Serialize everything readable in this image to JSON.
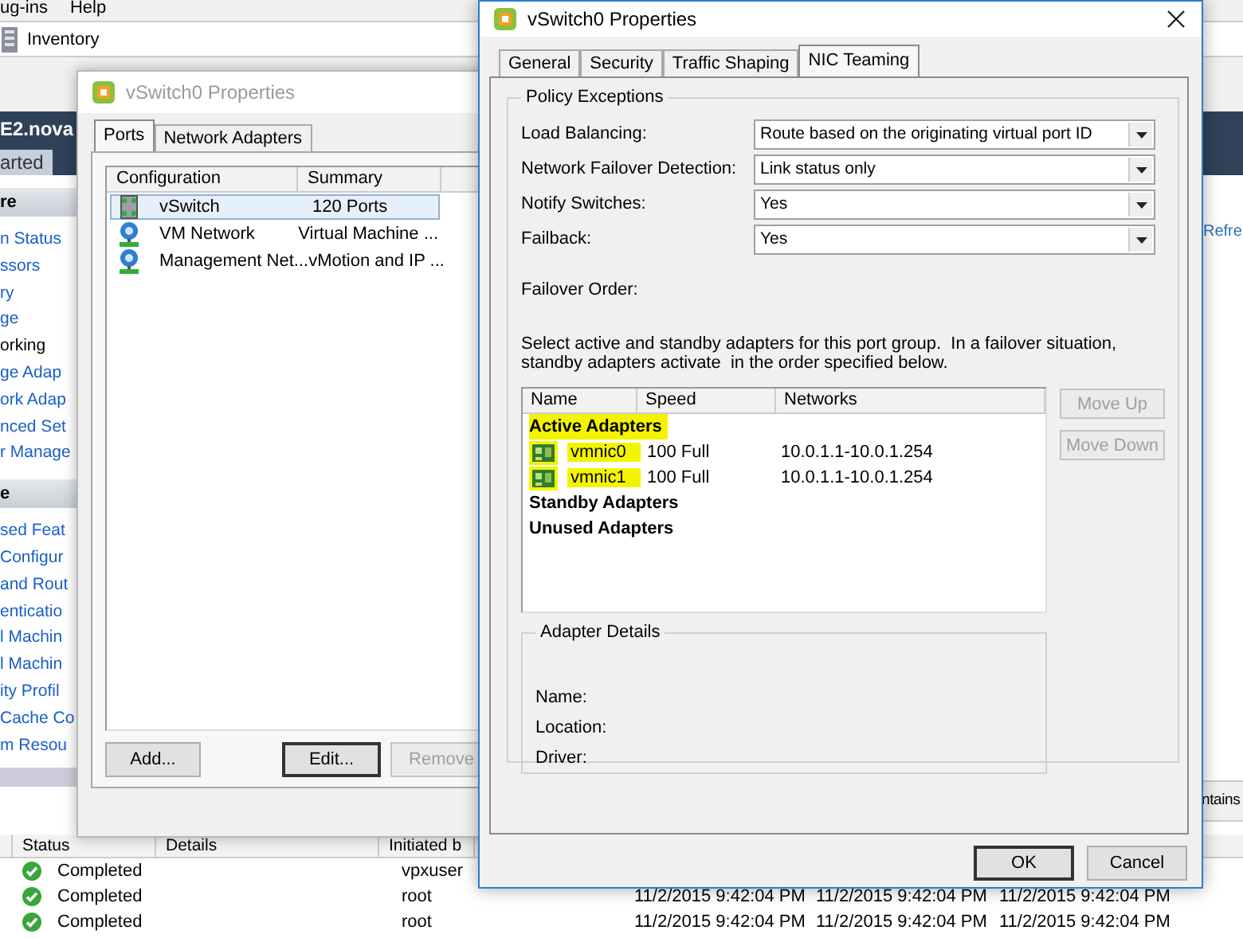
{
  "background_app": {
    "menu": [
      "ug-ins",
      "Help"
    ],
    "location": "Inventory",
    "host_title": "E2.nova",
    "tab": "arted",
    "sidebar_sections": [
      {
        "title": "re",
        "items": [
          {
            "label": "n Status",
            "selected": false
          },
          {
            "label": "ssors",
            "selected": false
          },
          {
            "label": "ry",
            "selected": false
          },
          {
            "label": "ge",
            "selected": false
          },
          {
            "label": "orking",
            "selected": true
          },
          {
            "label": "ge Adap",
            "selected": false
          },
          {
            "label": "ork Adap",
            "selected": false
          },
          {
            "label": "nced Set",
            "selected": false
          },
          {
            "label": "r Manage",
            "selected": false
          }
        ]
      },
      {
        "title": "e",
        "items": [
          {
            "label": "sed Feat",
            "selected": false
          },
          {
            "label": "Configur",
            "selected": false
          },
          {
            "label": "and Rout",
            "selected": false
          },
          {
            "label": "enticatio",
            "selected": false
          },
          {
            "label": "l Machin",
            "selected": false
          },
          {
            "label": "l Machin",
            "selected": false
          },
          {
            "label": "ity Profil",
            "selected": false
          },
          {
            "label": "Cache Co",
            "selected": false
          },
          {
            "label": "m Resou",
            "selected": false
          }
        ]
      }
    ],
    "refresh_link": "Refre",
    "filter_label": "ntains",
    "tasks": {
      "columns": [
        "Status",
        "Details",
        "Initiated b"
      ],
      "rows": [
        {
          "status": "Completed",
          "initiated_by": "vpxuser"
        },
        {
          "status": "Completed",
          "initiated_by": "root",
          "times": [
            "11/2/2015 9:42:04 PM",
            "11/2/2015 9:42:04 PM",
            "11/2/2015 9:42:04 PM"
          ]
        },
        {
          "status": "Completed",
          "initiated_by": "root",
          "times": [
            "11/2/2015 9:42:04 PM",
            "11/2/2015 9:42:04 PM",
            "11/2/2015 9:42:04 PM"
          ]
        }
      ]
    }
  },
  "ports_window": {
    "title": "vSwitch0 Properties",
    "tabs": [
      {
        "label": "Ports",
        "selected": true
      },
      {
        "label": "Network Adapters",
        "selected": false
      }
    ],
    "columns": [
      "Configuration",
      "Summary"
    ],
    "rows": [
      {
        "kind": "switch",
        "configuration": "vSwitch",
        "summary": "120 Ports",
        "selected": true
      },
      {
        "kind": "network",
        "configuration": "VM Network",
        "summary": "Virtual Machine ...",
        "selected": false
      },
      {
        "kind": "network",
        "configuration": "Management Net...",
        "summary": "vMotion and IP ...",
        "selected": false
      }
    ],
    "buttons": [
      {
        "label": "Add...",
        "default": false,
        "disabled": false
      },
      {
        "label": "Edit...",
        "default": true,
        "disabled": false
      },
      {
        "label": "Remove",
        "default": false,
        "disabled": true
      }
    ]
  },
  "teaming_window": {
    "title": "vSwitch0 Properties",
    "tabs": [
      {
        "label": "General",
        "selected": false
      },
      {
        "label": "Security",
        "selected": false
      },
      {
        "label": "Traffic Shaping",
        "selected": false
      },
      {
        "label": "NIC Teaming",
        "selected": true
      }
    ],
    "policy_group": "Policy Exceptions",
    "settings": [
      {
        "label": "Load Balancing:",
        "value": "Route based on the originating virtual port ID"
      },
      {
        "label": "Network Failover Detection:",
        "value": "Link status only"
      },
      {
        "label": "Notify Switches:",
        "value": "Yes"
      },
      {
        "label": "Failback:",
        "value": "Yes"
      }
    ],
    "failover_label": "Failover Order:",
    "description": "Select active and standby adapters for this port group.  In a failover situation, standby adapters activate  in the order specified below.",
    "adapter_table": {
      "columns": [
        "Name",
        "Speed",
        "Networks"
      ],
      "groups": [
        {
          "title": "Active Adapters",
          "highlighted": true,
          "adapters": [
            {
              "name": "vmnic0",
              "speed": "100 Full",
              "networks": "10.0.1.1-10.0.1.254",
              "highlighted": true
            },
            {
              "name": "vmnic1",
              "speed": "100 Full",
              "networks": "10.0.1.1-10.0.1.254",
              "highlighted": true
            }
          ]
        },
        {
          "title": "Standby Adapters",
          "highlighted": false
        },
        {
          "title": "Unused Adapters",
          "highlighted": false
        }
      ]
    },
    "order_buttons": [
      {
        "label": "Move Up",
        "disabled": true
      },
      {
        "label": "Move Down",
        "disabled": true
      }
    ],
    "details": {
      "title": "Adapter Details",
      "fields": [
        "Name:",
        "Location:",
        "Driver:"
      ]
    },
    "buttons": [
      {
        "label": "OK",
        "default": true
      },
      {
        "label": "Cancel",
        "default": false
      }
    ]
  }
}
